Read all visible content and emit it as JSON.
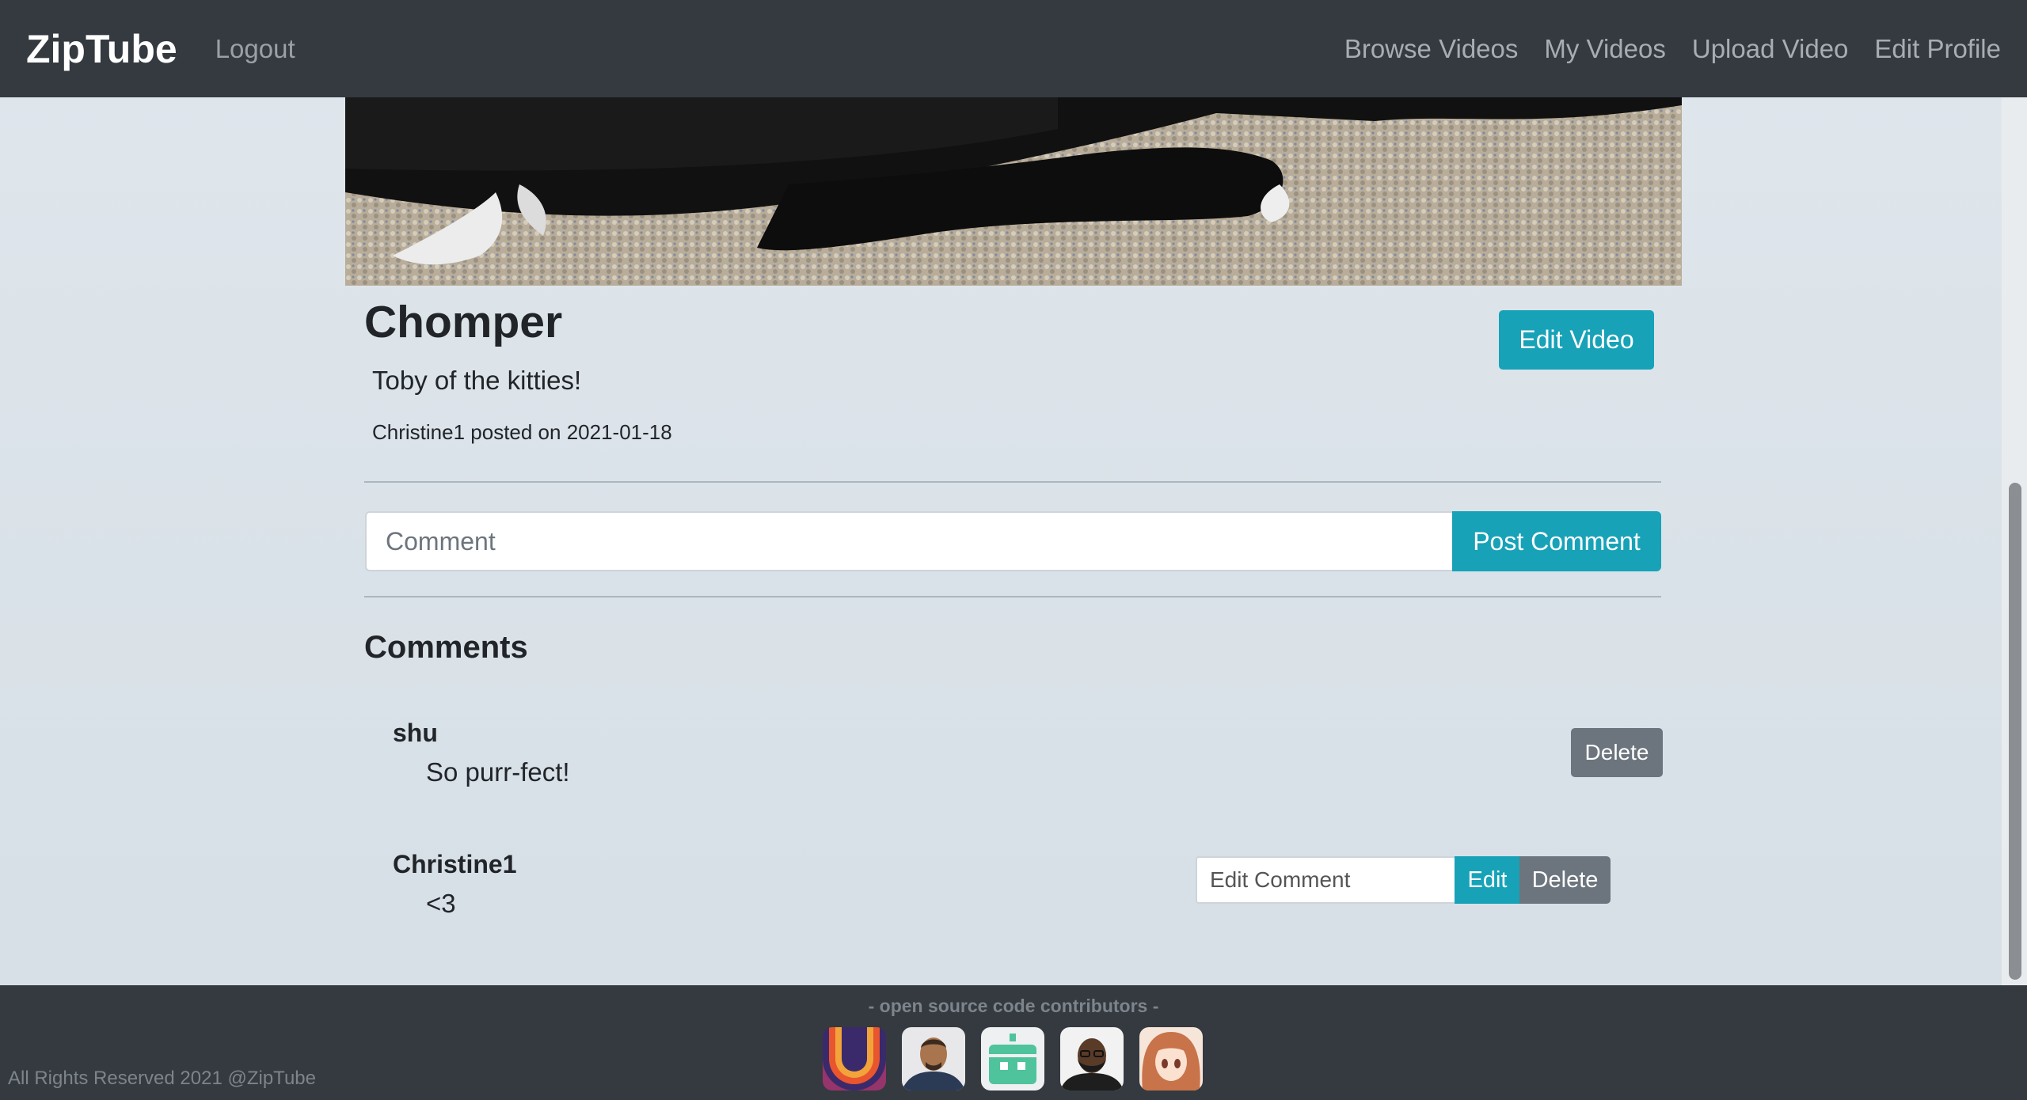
{
  "navbar": {
    "brand": "ZipTube",
    "logout": "Logout",
    "links": [
      "Browse Videos",
      "My Videos",
      "Upload Video",
      "Edit Profile"
    ]
  },
  "video": {
    "title": "Chomper",
    "description": "Toby of the kitties!",
    "meta": "Christine1 posted on 2021-01-18",
    "edit_label": "Edit Video"
  },
  "comment_form": {
    "placeholder": "Comment",
    "submit_label": "Post Comment"
  },
  "comments": {
    "heading": "Comments",
    "items": [
      {
        "user": "shu",
        "text": "So purr-fect!",
        "delete_label": "Delete"
      },
      {
        "user": "Christine1",
        "text": "<3",
        "edit_placeholder": "Edit Comment",
        "edit_label": "Edit",
        "delete_label": "Delete"
      }
    ]
  },
  "footer": {
    "title": "-  open source code contributors -",
    "copyright": "All Rights Reserved 2021 @ZipTube",
    "avatars": [
      "logo-avatar",
      "man-avatar",
      "robot-avatar",
      "bearded-man-avatar",
      "anime-girl-avatar"
    ]
  },
  "colors": {
    "navbar": "#343a40",
    "primary": "#17a2b8",
    "secondary": "#6c757d"
  }
}
